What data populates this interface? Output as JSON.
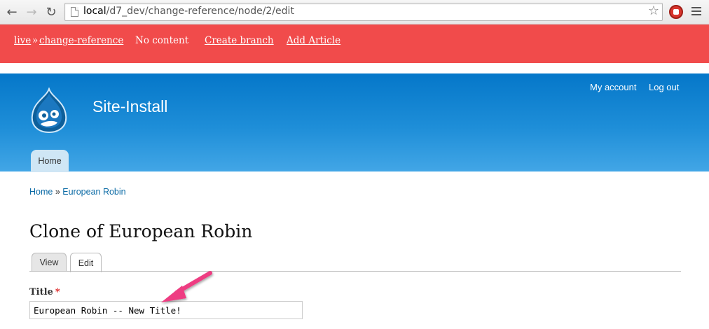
{
  "browser": {
    "url_host": "local",
    "url_path": "/d7_dev/change-reference/node/2/edit",
    "back_glyph": "←",
    "forward_glyph": "→",
    "reload_glyph": "↻",
    "star_glyph": "☆"
  },
  "workbench": {
    "crumb_live": "live",
    "crumb_sep": "»",
    "crumb_branch": "change-reference",
    "no_content": "No content",
    "create_branch": "Create branch",
    "add_article": "Add Article",
    "bar_color": "#f14b4b"
  },
  "header": {
    "site_name": "Site-Install",
    "my_account": "My account",
    "log_out": "Log out",
    "home_tab": "Home",
    "header_color": "#0577c9"
  },
  "breadcrumb": {
    "home": "Home",
    "sep": "»",
    "current": "European Robin"
  },
  "page": {
    "title": "Clone of European Robin",
    "tabs": [
      {
        "label": "View",
        "active": false
      },
      {
        "label": "Edit",
        "active": true
      }
    ]
  },
  "form": {
    "title_label": "Title",
    "required_mark": "*",
    "title_value": "European Robin -- New Title!"
  },
  "annotation": {
    "arrow_color": "#ee3d82"
  }
}
